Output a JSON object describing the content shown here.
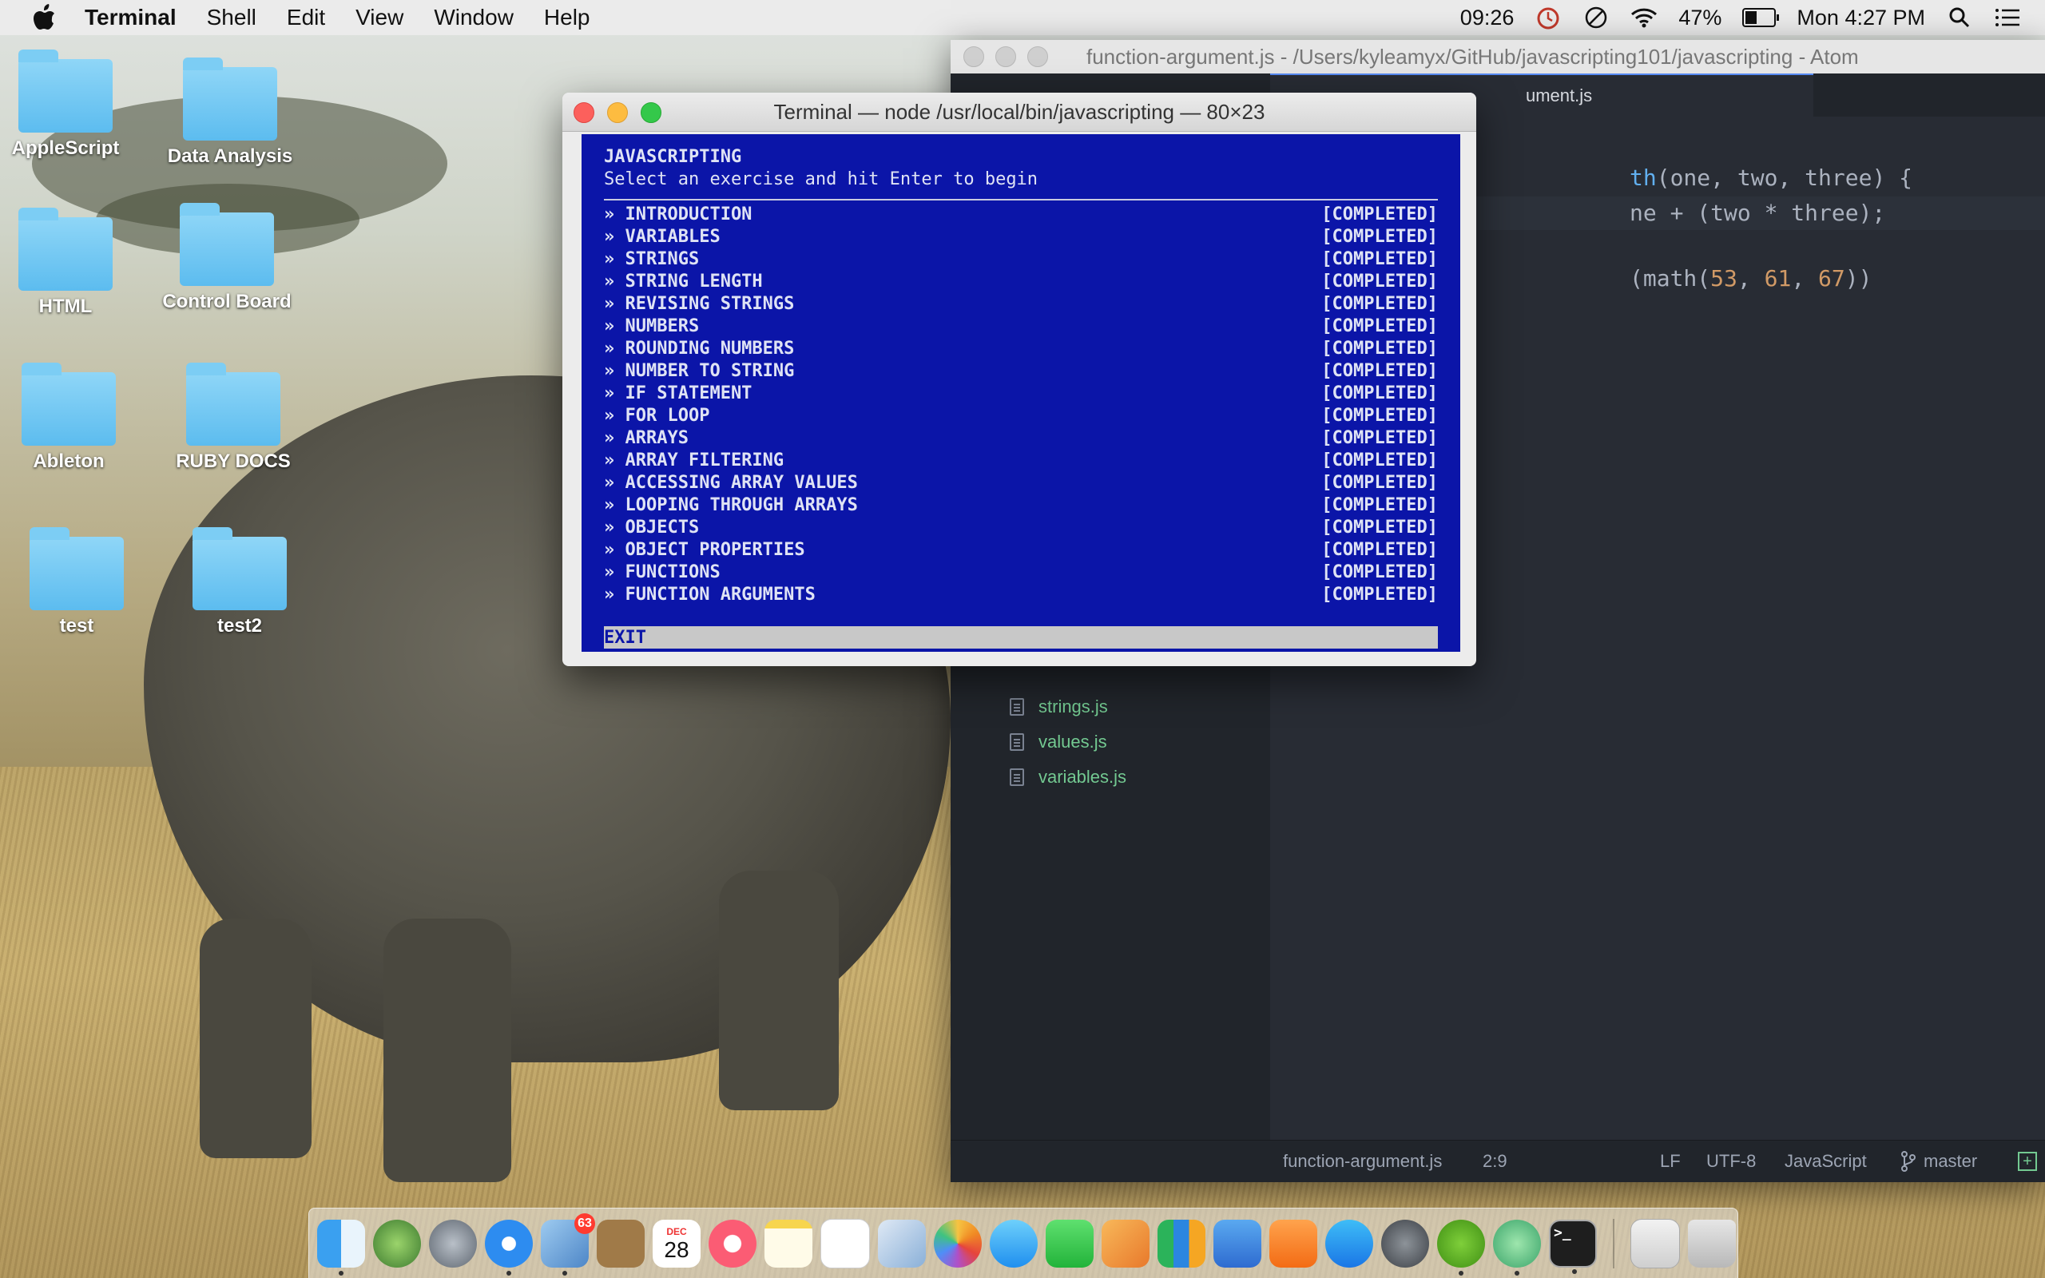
{
  "menubar": {
    "app_name": "Terminal",
    "menus": [
      "Shell",
      "Edit",
      "View",
      "Window",
      "Help"
    ],
    "timer": "09:26",
    "battery_percent": "47%",
    "battery_level": 0.47,
    "clock": "Mon 4:27 PM"
  },
  "desktop": {
    "icons": [
      "AppleScript",
      "Data Analysis",
      "HTML",
      "Control Board",
      "Ableton",
      "RUBY DOCS",
      "test",
      "test2"
    ]
  },
  "atom": {
    "title": "function-argument.js - /Users/kyleamyx/GitHub/javascripting101/javascripting - Atom",
    "tab_label": "ument.js",
    "tree_files": [
      "strings.js",
      "values.js",
      "variables.js"
    ],
    "code": {
      "line1_fn": "th",
      "line1_rest": "(one, two, three) {",
      "line2": "ne + (two * three);",
      "line3_pre": "(math(",
      "line3_n1": "53",
      "line3_n2": "61",
      "line3_n3": "67",
      "line3_post": "))"
    },
    "status": {
      "file": "function-argument.js",
      "cursor": "2:9",
      "line_ending": "LF",
      "encoding": "UTF-8",
      "grammar": "JavaScript",
      "branch": "master"
    }
  },
  "terminal": {
    "title": "Terminal — node /usr/local/bin/javascripting — 80×23",
    "heading": "JAVASCRIPTING",
    "subheading": "Select an exercise and hit Enter to begin",
    "exercises": [
      {
        "name": "» INTRODUCTION",
        "status": "[COMPLETED]"
      },
      {
        "name": "» VARIABLES",
        "status": "[COMPLETED]"
      },
      {
        "name": "» STRINGS",
        "status": "[COMPLETED]"
      },
      {
        "name": "» STRING LENGTH",
        "status": "[COMPLETED]"
      },
      {
        "name": "» REVISING STRINGS",
        "status": "[COMPLETED]"
      },
      {
        "name": "» NUMBERS",
        "status": "[COMPLETED]"
      },
      {
        "name": "» ROUNDING NUMBERS",
        "status": "[COMPLETED]"
      },
      {
        "name": "» NUMBER TO STRING",
        "status": "[COMPLETED]"
      },
      {
        "name": "» IF STATEMENT",
        "status": "[COMPLETED]"
      },
      {
        "name": "» FOR LOOP",
        "status": "[COMPLETED]"
      },
      {
        "name": "» ARRAYS",
        "status": "[COMPLETED]"
      },
      {
        "name": "» ARRAY FILTERING",
        "status": "[COMPLETED]"
      },
      {
        "name": "» ACCESSING ARRAY VALUES",
        "status": "[COMPLETED]"
      },
      {
        "name": "» LOOPING THROUGH ARRAYS",
        "status": "[COMPLETED]"
      },
      {
        "name": "» OBJECTS",
        "status": "[COMPLETED]"
      },
      {
        "name": "» OBJECT PROPERTIES",
        "status": "[COMPLETED]"
      },
      {
        "name": "» FUNCTIONS",
        "status": "[COMPLETED]"
      },
      {
        "name": "» FUNCTION ARGUMENTS",
        "status": "[COMPLETED]"
      }
    ],
    "exit_label": "EXIT"
  },
  "dock": {
    "mail_badge": "63",
    "calendar_month": "DEC",
    "calendar_day": "28"
  },
  "colors": {
    "terminal_bg": "#0b15a8",
    "atom_bg": "#282c34",
    "git_green": "#73c991"
  }
}
